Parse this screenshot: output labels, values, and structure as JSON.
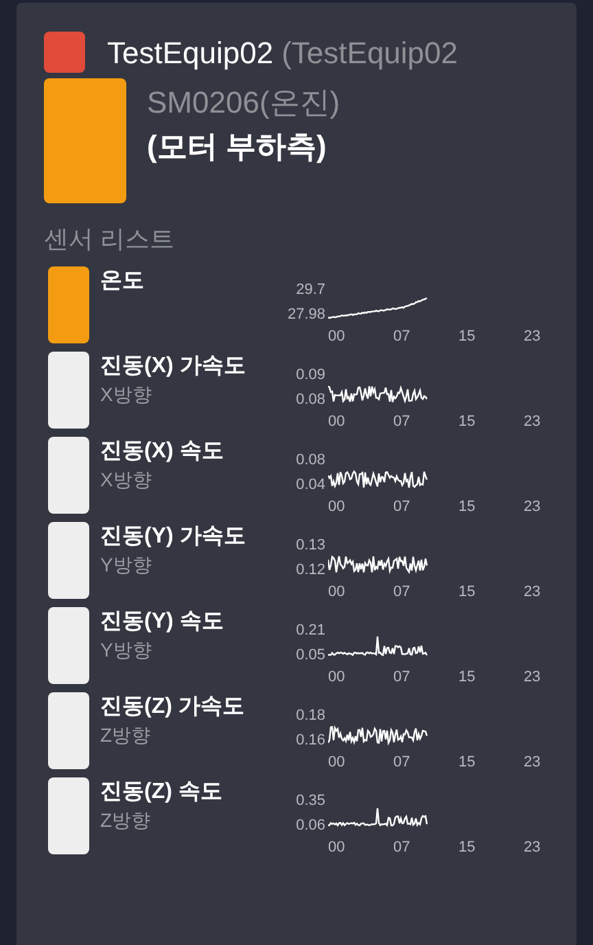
{
  "equipment": {
    "color": "#e04b3a",
    "name": "TestEquip02",
    "code": "(TestEquip02"
  },
  "sensor_group": {
    "color": "#f39c12",
    "model": "SM0206(온진)",
    "location": "(모터 부하측)"
  },
  "section_title": "센서 리스트",
  "sensors": [
    {
      "name": "온도",
      "color": "#f39c12",
      "max": "29.7",
      "min": "27.98",
      "kind": "rising",
      "ticks": [
        "00",
        "07",
        "15",
        "23"
      ]
    },
    {
      "name": "진동(X) 가속도",
      "direction": "X방향",
      "color": "#eeeeee",
      "max": "0.09",
      "min": "0.08",
      "kind": "noise",
      "ticks": [
        "00",
        "07",
        "15",
        "23"
      ]
    },
    {
      "name": "진동(X) 속도",
      "direction": "X방향",
      "color": "#eeeeee",
      "max": "0.08",
      "min": "0.04",
      "kind": "noise",
      "ticks": [
        "00",
        "07",
        "15",
        "23"
      ]
    },
    {
      "name": "진동(Y) 가속도",
      "direction": "Y방향",
      "color": "#eeeeee",
      "max": "0.13",
      "min": "0.12",
      "kind": "noise",
      "ticks": [
        "00",
        "07",
        "15",
        "23"
      ]
    },
    {
      "name": "진동(Y) 속도",
      "direction": "Y방향",
      "color": "#eeeeee",
      "max": "0.21",
      "min": "0.05",
      "kind": "spikes",
      "ticks": [
        "00",
        "07",
        "15",
        "23"
      ]
    },
    {
      "name": "진동(Z) 가속도",
      "direction": "Z방향",
      "color": "#eeeeee",
      "max": "0.18",
      "min": "0.16",
      "kind": "noise",
      "ticks": [
        "00",
        "07",
        "15",
        "23"
      ]
    },
    {
      "name": "진동(Z) 속도",
      "direction": "Z방향",
      "color": "#eeeeee",
      "max": "0.35",
      "min": "0.06",
      "kind": "spikes",
      "ticks": [
        "00",
        "07",
        "15",
        "23"
      ]
    }
  ]
}
